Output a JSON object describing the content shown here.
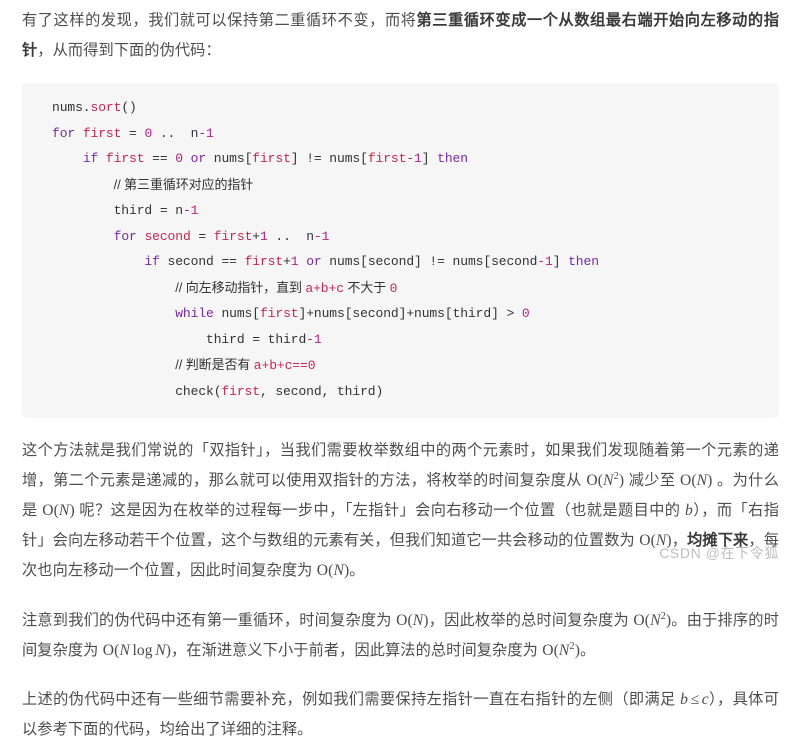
{
  "document": {
    "intro_paragraph": {
      "lead": "有了这样的发现，我们就可以保持第二重循环不变，而将",
      "bold": "第三重循环变成一个从数组最右端开始向左移动的指针",
      "tail": "，从而得到下面的伪代码："
    },
    "code_block": {
      "language": "pseudocode",
      "lines": [
        "nums.sort()",
        "for first = 0 .. n-1",
        "    if first == 0 or nums[first] != nums[first-1] then",
        "        // 第三重循环对应的指针",
        "        third = n-1",
        "        for second = first+1 .. n-1",
        "            if second == first+1 or nums[second] != nums[second-1] then",
        "                // 向左移动指针，直到 a+b+c 不大于 0",
        "                while nums[first]+nums[second]+nums[third] > 0",
        "                    third = third-1",
        "                // 判断是否有 a+b+c==0",
        "                check(first, second, third)"
      ]
    },
    "paragraph_two_pointer": {
      "s1": "这个方法就是我们常说的「双指针」，当我们需要枚举数组中的两个元素时，如果我们发现随着第一个元素的递增，第二个元素是递减的，那么就可以使用双指针的方法，将枚举的时间复杂度从 ",
      "m1": "O(N²)",
      "s2": " 减少至 ",
      "m2": "O(N)",
      "s3": " 。为什么是 ",
      "m3": "O(N)",
      "s4": " 呢？这是因为在枚举的过程每一步中，「左指针」会向右移动一个位置（也就是题目中的 ",
      "m4": "b",
      "s5": "），而「右指针」会向左移动若干个位置，这个与数组的元素有关，但我们知道它一共会移动的位置数为 ",
      "m5": "O(N)",
      "s6": "，",
      "bold1": "均摊下来",
      "s7": "，每次也向左移动一个位置，因此时间复杂度为 ",
      "m6": "O(N)",
      "s8": "。"
    },
    "paragraph_complexity": {
      "s1": "注意到我们的伪代码中还有第一重循环，时间复杂度为 ",
      "m1": "O(N)",
      "s2": "，因此枚举的总时间复杂度为 ",
      "m2": "O(N²)",
      "s3": "。由于排序的时间复杂度为 ",
      "m3": "O(N log N)",
      "s4": "，在渐进意义下小于前者，因此算法的总时间复杂度为 ",
      "m4": "O(N²)",
      "s5": "。"
    },
    "paragraph_details": {
      "s1": "上述的伪代码中还有一些细节需要补充，例如我们需要保持左指针一直在右指针的左侧（即满足 ",
      "m1": "b ≤ c",
      "s2": "），具体可以参考下面的代码，均给出了详细的注释。"
    },
    "watermark": "CSDN @在下令狐"
  },
  "colors": {
    "page_background": "#ffffff",
    "body_text": "#4d4d4d",
    "code_background": "#f6f6f6",
    "code_text": "#333333",
    "keyword": "#7928a1",
    "variable": "#c7254e",
    "number": "#b5207f",
    "watermark": "#bdbdbd"
  }
}
